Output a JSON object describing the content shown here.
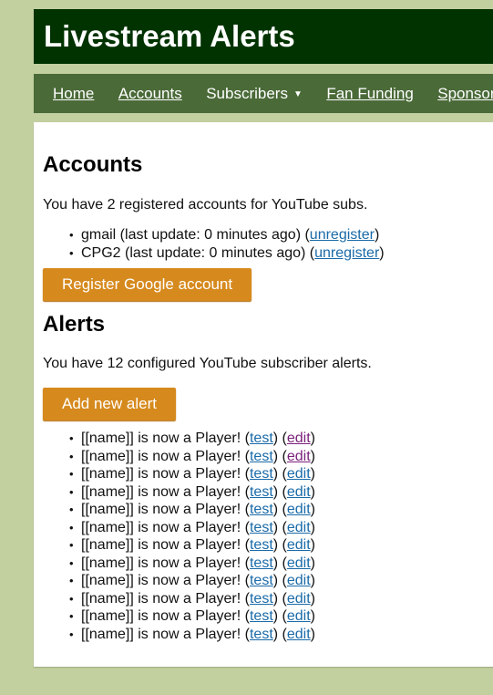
{
  "header": {
    "title": "Livestream Alerts"
  },
  "nav": {
    "items": [
      {
        "label": "Home"
      },
      {
        "label": "Accounts"
      },
      {
        "label": "Subscribers",
        "caret": "▼"
      },
      {
        "label": "Fan Funding"
      },
      {
        "label": "Sponsors"
      }
    ]
  },
  "accounts": {
    "title": "Accounts",
    "summary": "You have 2 registered accounts for YouTube subs.",
    "items": [
      {
        "text": "gmail (last update: 0 minutes ago) (",
        "link": "unregister",
        "suffix": ")"
      },
      {
        "text": "CPG2 (last update: 0 minutes ago) (",
        "link": "unregister",
        "suffix": ")"
      }
    ],
    "register_button": "Register Google account"
  },
  "alerts": {
    "title": "Alerts",
    "summary": "You have 12 configured YouTube subscriber alerts.",
    "add_button": "Add new alert",
    "items": [
      {
        "text": "[[name]] is now a Player! (",
        "test": "test",
        "mid": ") (",
        "edit": "edit",
        "suffix": ")",
        "edit_visited": true
      },
      {
        "text": "[[name]] is now a Player! (",
        "test": "test",
        "mid": ") (",
        "edit": "edit",
        "suffix": ")",
        "edit_visited": true
      },
      {
        "text": "[[name]] is now a Player! (",
        "test": "test",
        "mid": ") (",
        "edit": "edit",
        "suffix": ")",
        "edit_visited": false
      },
      {
        "text": "[[name]] is now a Player! (",
        "test": "test",
        "mid": ") (",
        "edit": "edit",
        "suffix": ")",
        "edit_visited": false
      },
      {
        "text": "[[name]] is now a Player! (",
        "test": "test",
        "mid": ") (",
        "edit": "edit",
        "suffix": ")",
        "edit_visited": false
      },
      {
        "text": "[[name]] is now a Player! (",
        "test": "test",
        "mid": ") (",
        "edit": "edit",
        "suffix": ")",
        "edit_visited": false
      },
      {
        "text": "[[name]] is now a Player! (",
        "test": "test",
        "mid": ") (",
        "edit": "edit",
        "suffix": ")",
        "edit_visited": false
      },
      {
        "text": "[[name]] is now a Player! (",
        "test": "test",
        "mid": ") (",
        "edit": "edit",
        "suffix": ")",
        "edit_visited": false
      },
      {
        "text": "[[name]] is now a Player! (",
        "test": "test",
        "mid": ") (",
        "edit": "edit",
        "suffix": ")",
        "edit_visited": false
      },
      {
        "text": "[[name]] is now a Player! (",
        "test": "test",
        "mid": ") (",
        "edit": "edit",
        "suffix": ")",
        "edit_visited": false
      },
      {
        "text": "[[name]] is now a Player! (",
        "test": "test",
        "mid": ") (",
        "edit": "edit",
        "suffix": ")",
        "edit_visited": false
      },
      {
        "text": "[[name]] is now a Player! (",
        "test": "test",
        "mid": ") (",
        "edit": "edit",
        "suffix": ")",
        "edit_visited": false
      }
    ]
  },
  "colors": {
    "page_bg": "#c2cf9f",
    "header_bg": "#003300",
    "nav_bg": "#4a6a38",
    "button_bg": "#d68a1e",
    "link": "#1a6aa8",
    "link_visited": "#7a1f7a"
  }
}
